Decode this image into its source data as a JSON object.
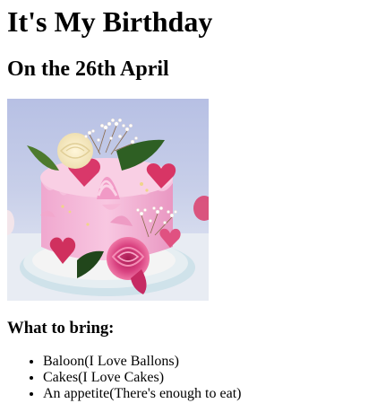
{
  "page": {
    "title": "It's My Birthday",
    "subtitle": "On the 26th April",
    "image_description_name": "birthday-cake-photo",
    "bring_heading": "What to bring:",
    "bring_items": [
      "Baloon(I Love Ballons)",
      "Cakes(I Love Cakes)",
      "An appetite(There's enough to eat)"
    ]
  },
  "colors": {
    "background_top": "#b9c2e4",
    "cake_pink": "#f4b6d8",
    "rose": "#d83b7a",
    "leaf": "#2f6a2a",
    "board": "#d7e7ef"
  }
}
